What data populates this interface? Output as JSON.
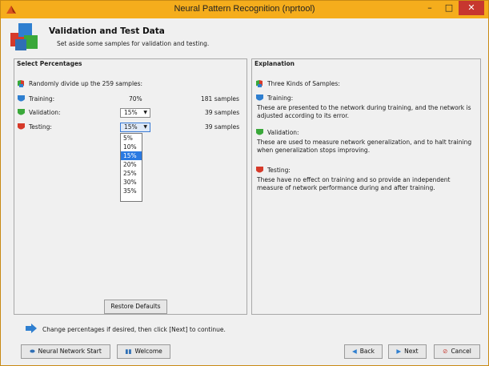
{
  "window": {
    "title": "Neural Pattern Recognition (nprtool)"
  },
  "header": {
    "title": "Validation and Test Data",
    "subtitle": "Set aside some samples for validation and testing."
  },
  "left_panel": {
    "title": "Select Percentages",
    "intro": "Randomly divide up the 259 samples:",
    "rows": [
      {
        "label": "Training:",
        "value": "70%",
        "samples": "181 samples"
      },
      {
        "label": "Validation:",
        "value": "15%",
        "samples": "39 samples"
      },
      {
        "label": "Testing:",
        "value": "15%",
        "samples": "39 samples"
      }
    ],
    "dropdown_options": [
      "5%",
      "10%",
      "15%",
      "20%",
      "25%",
      "30%",
      "35%"
    ],
    "dropdown_selected": "15%",
    "restore_button": "Restore Defaults"
  },
  "right_panel": {
    "title": "Explanation",
    "intro": "Three Kinds of Samples:",
    "sections": [
      {
        "heading": "Training:",
        "text": "These are presented to the network during training, and the network is adjusted according to its error."
      },
      {
        "heading": "Validation:",
        "text": "These are used to measure network generalization, and to halt training when generalization stops improving."
      },
      {
        "heading": "Testing:",
        "text": "These have no effect on training and so provide an independent measure of network performance during and after training."
      }
    ]
  },
  "footer": {
    "hint": "Change percentages if desired, then click [Next] to continue.",
    "buttons": {
      "nn_start": "Neural Network Start",
      "welcome": "Welcome",
      "back": "Back",
      "next": "Next",
      "cancel": "Cancel"
    }
  },
  "colors": {
    "titlebar": "#f5ad1c",
    "close": "#c7372f",
    "selection": "#2a7ae2"
  }
}
